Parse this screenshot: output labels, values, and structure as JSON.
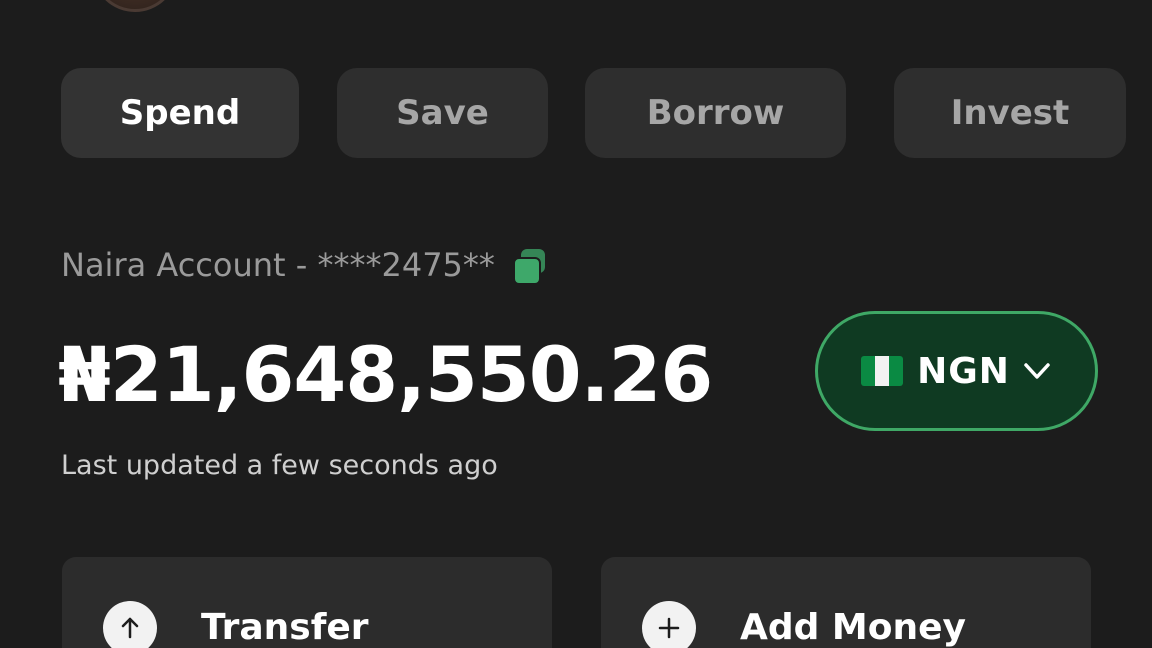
{
  "tabs": [
    {
      "label": "Spend",
      "active": true
    },
    {
      "label": "Save",
      "active": false
    },
    {
      "label": "Borrow",
      "active": false
    },
    {
      "label": "Invest",
      "active": false
    }
  ],
  "account": {
    "label": "Naira Account - ****2475**",
    "copy_icon": "copy-icon"
  },
  "balance": {
    "amount": "₦21,648,550.26",
    "updated": "Last updated a few seconds ago"
  },
  "currency": {
    "code": "NGN",
    "flag": "nigeria-flag-icon"
  },
  "actions": [
    {
      "label": "Transfer",
      "icon": "arrow-up-icon"
    },
    {
      "label": "Add Money",
      "icon": "plus-icon"
    }
  ],
  "colors": {
    "background": "#1c1c1c",
    "tab_background": "#2e2e2e",
    "accent_green": "#3fa866",
    "pill_background": "#0f3a22"
  }
}
